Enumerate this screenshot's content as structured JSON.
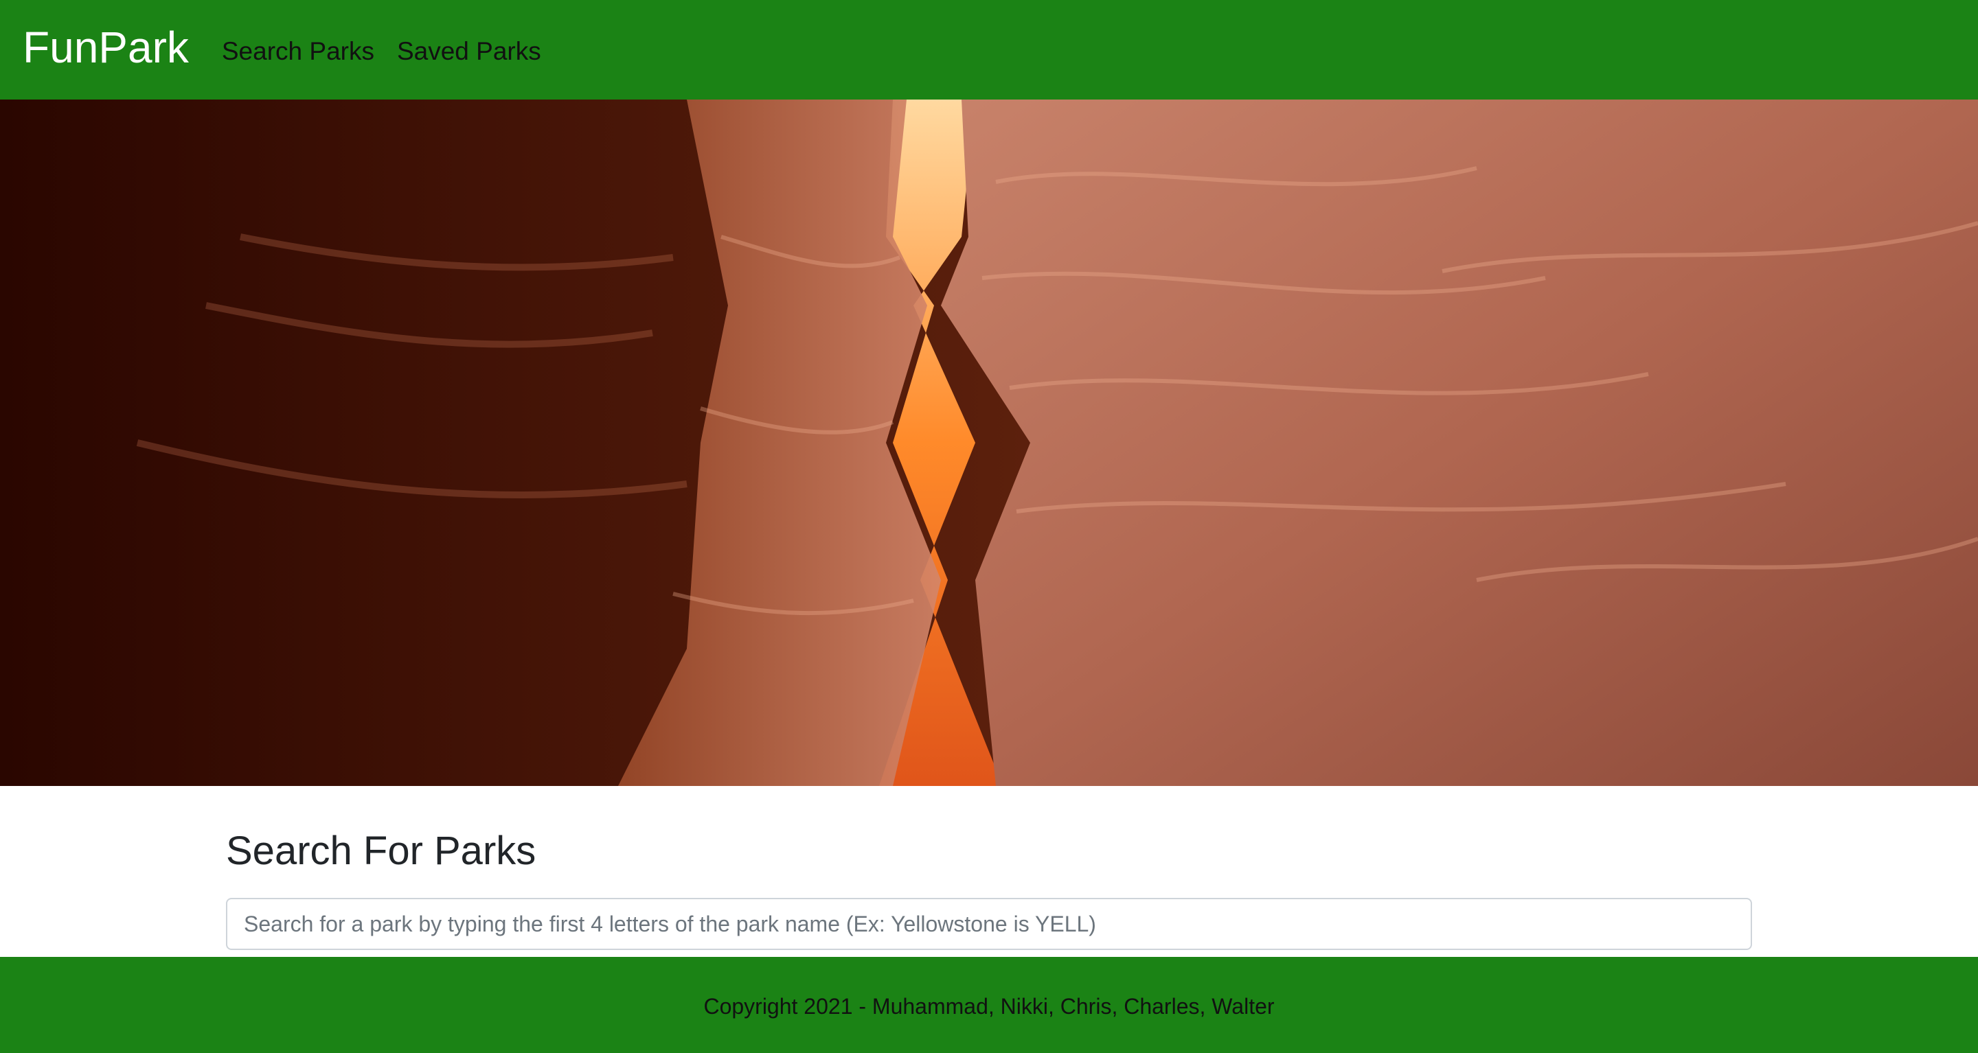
{
  "navbar": {
    "brand": "FunPark",
    "links": [
      {
        "label": "Search Parks"
      },
      {
        "label": "Saved Parks"
      }
    ]
  },
  "hero": {
    "description": "canyon-photo"
  },
  "search": {
    "title": "Search For Parks",
    "input_value": "",
    "placeholder": "Search for a park by typing the first 4 letters of the park name (Ex: Yellowstone is YELL)"
  },
  "footer": {
    "copyright": "Copyright 2021 - Muhammad, Nikki, Chris, Charles, Walter"
  },
  "colors": {
    "brand": "#1b8315",
    "text_dark": "#212529",
    "placeholder": "#6c757d"
  }
}
